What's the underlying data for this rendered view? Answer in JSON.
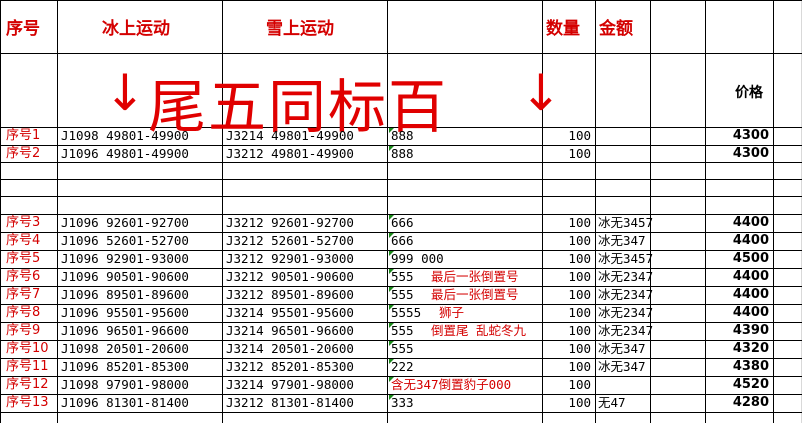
{
  "header": {
    "col1": "序号",
    "col2": "冰上运动",
    "col3": "雪上运动",
    "col4": "",
    "col5": "数量",
    "col6": "金额"
  },
  "banner": {
    "arrow_left": "↓",
    "text": "尾五同标百",
    "arrow_right": "↓",
    "price_label": "价格"
  },
  "rows": [
    {
      "seq": "序号1",
      "ice": "J1098 49801-49900",
      "snow": "J3214 49801-49900",
      "note": "888",
      "qty": "100",
      "amt": "",
      "price": "4300"
    },
    {
      "seq": "序号2",
      "ice": "J1096 49801-49900",
      "snow": "J3212 49801-49900",
      "note": "888",
      "qty": "100",
      "amt": "",
      "price": "4300"
    },
    {
      "seq": "序号3",
      "ice": "J1096 92601-92700",
      "snow": "J3212 92601-92700",
      "note": "666",
      "qty": "100",
      "amt": "冰无3457",
      "price": "4400"
    },
    {
      "seq": "序号4",
      "ice": "J1096 52601-52700",
      "snow": "J3212 52601-52700",
      "note": "666",
      "qty": "100",
      "amt": "冰无347",
      "price": "4400"
    },
    {
      "seq": "序号5",
      "ice": "J1096 92901-93000",
      "snow": "J3212 92901-93000",
      "note": "999  000",
      "qty": "100",
      "amt": "冰无3457",
      "price": "4500"
    },
    {
      "seq": "序号6",
      "ice": "J1096 90501-90600",
      "snow": "J3212 90501-90600",
      "note": "555",
      "note_red": "最后一张倒置号",
      "qty": "100",
      "amt": "冰无2347",
      "price": "4400"
    },
    {
      "seq": "序号7",
      "ice": "J1096 89501-89600",
      "snow": "J3212 89501-89600",
      "note": "555",
      "note_red": "最后一张倒置号",
      "qty": "100",
      "amt": "冰无2347",
      "price": "4400"
    },
    {
      "seq": "序号8",
      "ice": "J1096 95501-95600",
      "snow": "J3214 95501-95600",
      "note": "5555",
      "note_red": "狮子",
      "qty": "100",
      "amt": "冰无2347",
      "price": "4400"
    },
    {
      "seq": "序号9",
      "ice": "J1096 96501-96600",
      "snow": "J3214 96501-96600",
      "note": "555",
      "note_red": "倒置尾 乱蛇冬九",
      "qty": "100",
      "amt": "冰无2347",
      "price": "4390"
    },
    {
      "seq": "序号10",
      "ice": "J1098 20501-20600",
      "snow": "J3214 20501-20600",
      "note": "555",
      "qty": "100",
      "amt": "冰无347",
      "price": "4320"
    },
    {
      "seq": "序号11",
      "ice": "J1096 85201-85300",
      "snow": "J3212 85201-85300",
      "note": "222",
      "qty": "100",
      "amt": "冰无347",
      "price": "4380"
    },
    {
      "seq": "序号12",
      "ice": "J1098 97901-98000",
      "snow": "J3214 97901-98000",
      "note": "",
      "note_red": "含无347倒置豹子000",
      "qty": "100",
      "amt": "",
      "price": "4520"
    },
    {
      "seq": "序号13",
      "ice": "J1096 81301-81400",
      "snow": "J3212 81301-81400",
      "note": "333",
      "qty": "100",
      "amt": "无47",
      "price": "4280"
    }
  ],
  "colors": {
    "header_red": "#d40000",
    "banner_red": "#e00000",
    "grid": "#000000",
    "cell_marker": "#1a8a1a"
  }
}
